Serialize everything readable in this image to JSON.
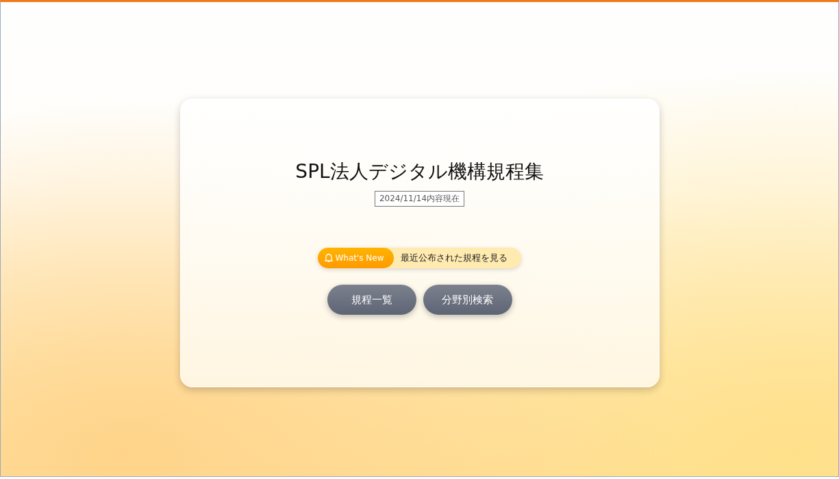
{
  "title": "SPL法人デジタル機構規程集",
  "date_badge": "2024/11/14内容現在",
  "whats_new": {
    "tag": "What's New",
    "label": "最近公布された規程を見る"
  },
  "buttons": [
    "規程一覧",
    "分野別検索"
  ]
}
